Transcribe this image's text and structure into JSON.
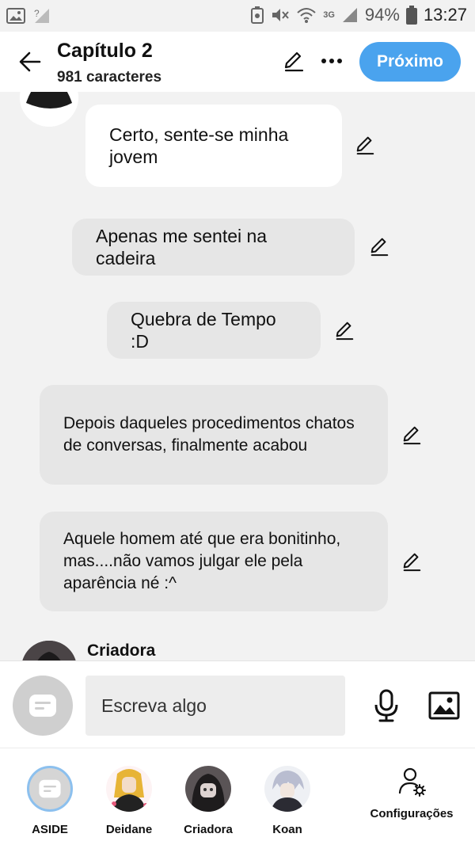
{
  "status_bar": {
    "battery_percent": "94%",
    "time": "13:27",
    "network_label": "3G"
  },
  "header": {
    "title": "Capítulo 2",
    "subtitle": "981 caracteres",
    "next_label": "Próximo"
  },
  "messages": [
    {
      "text": "Certo, sente-se minha jovem",
      "style": "white"
    },
    {
      "text": "Apenas me sentei na cadeira",
      "style": "gray"
    },
    {
      "text": "Quebra de Tempo :D",
      "style": "gray"
    },
    {
      "text": "Depois daqueles procedimentos chatos de conversas, finalmente acabou",
      "style": "gray"
    },
    {
      "text": "Aquele homem até que era bonitinho, mas....não vamos julgar ele pela aparência né :^",
      "style": "gray"
    }
  ],
  "next_author": "Criadora",
  "composer": {
    "placeholder": "Escreva algo"
  },
  "characters": [
    {
      "label": "ASIDE"
    },
    {
      "label": "Deidane"
    },
    {
      "label": "Criadora"
    },
    {
      "label": "Koan"
    }
  ],
  "settings_label": "Configurações",
  "colors": {
    "accent": "#4aa3ee",
    "background": "#f2f2f2",
    "bubble_gray": "#e6e6e6",
    "bubble_white": "#ffffff"
  }
}
